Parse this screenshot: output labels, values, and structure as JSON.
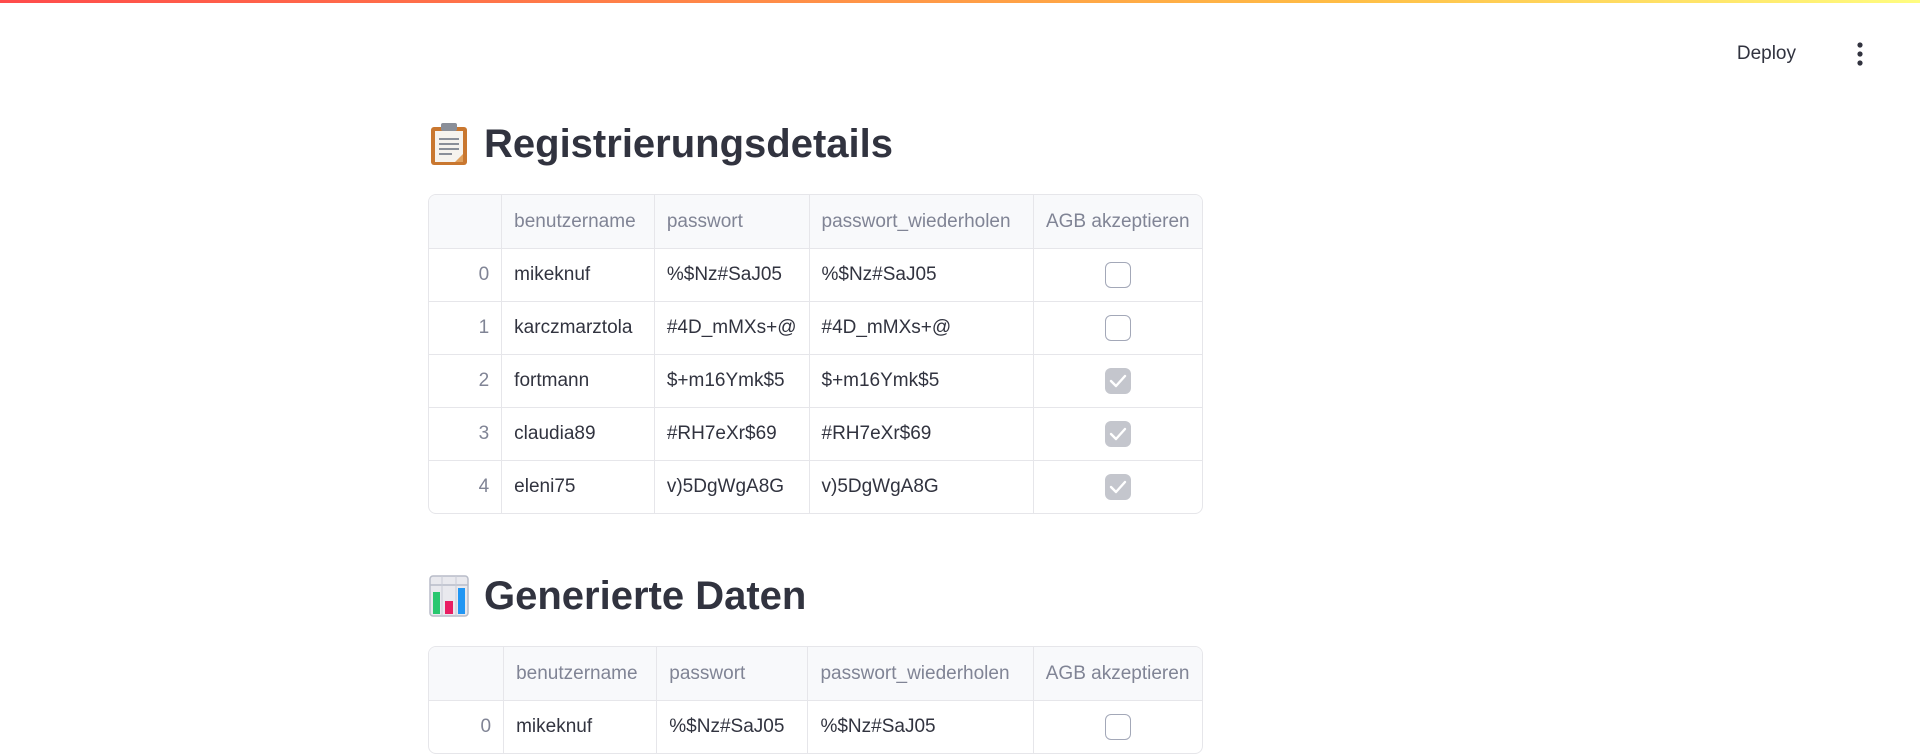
{
  "header": {
    "deploy_label": "Deploy",
    "menu_icon": "vertical-ellipsis-icon"
  },
  "colors": {
    "accent_gradient": [
      "#ff4b4b",
      "#ffbd45",
      "#fffd80"
    ],
    "text": "#31333f",
    "muted": "#808495",
    "border": "#e6e6ea"
  },
  "sections": [
    {
      "title": "Registrierungsdetails",
      "icon": "clipboard-icon",
      "columns": [
        "",
        "benutzername",
        "passwort",
        "passwort_wiederholen",
        "AGB akzeptieren"
      ],
      "rows": [
        {
          "index": "0",
          "benutzername": "mikeknuf",
          "passwort": "%$Nz#SaJ05",
          "passwort_wiederholen": "%$Nz#SaJ05",
          "agb": false
        },
        {
          "index": "1",
          "benutzername": "karczmarztola",
          "passwort": "#4D_mMXs+@",
          "passwort_wiederholen": "#4D_mMXs+@",
          "agb": false
        },
        {
          "index": "2",
          "benutzername": "fortmann",
          "passwort": "$+m16Ymk$5",
          "passwort_wiederholen": "$+m16Ymk$5",
          "agb": true
        },
        {
          "index": "3",
          "benutzername": "claudia89",
          "passwort": "#RH7eXr$69",
          "passwort_wiederholen": "#RH7eXr$69",
          "agb": true
        },
        {
          "index": "4",
          "benutzername": "eleni75",
          "passwort": "v)5DgWgA8G",
          "passwort_wiederholen": "v)5DgWgA8G",
          "agb": true
        }
      ]
    },
    {
      "title": "Generierte Daten",
      "icon": "bar-chart-icon",
      "columns": [
        "",
        "benutzername",
        "passwort",
        "passwort_wiederholen",
        "AGB akzeptieren"
      ],
      "rows": [
        {
          "index": "0",
          "benutzername": "mikeknuf",
          "passwort": "%$Nz#SaJ05",
          "passwort_wiederholen": "%$Nz#SaJ05",
          "agb": false
        }
      ]
    }
  ]
}
